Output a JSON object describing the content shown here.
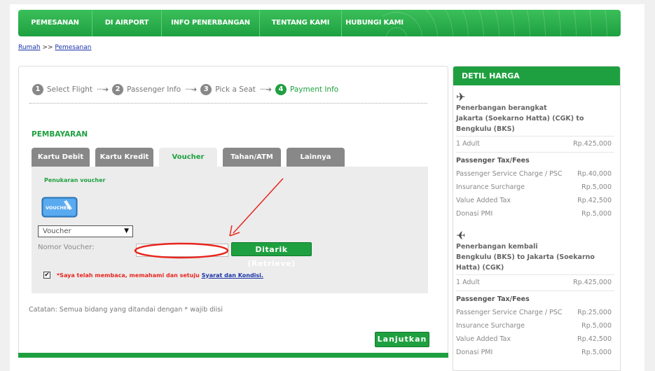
{
  "nav": {
    "items": [
      "PEMESANAN",
      "DI AIRPORT",
      "INFO PENERBANGAN",
      "TENTANG KAMI",
      "HUBUNGI KAMI"
    ]
  },
  "breadcrumb": {
    "home": "Rumah",
    "sep": ">>",
    "current": "Pemesanan"
  },
  "steps": [
    {
      "num": "1",
      "label": "Select Flight"
    },
    {
      "num": "2",
      "label": "Passenger Info"
    },
    {
      "num": "3",
      "label": "Pick a Seat"
    },
    {
      "num": "4",
      "label": "Payment Info"
    }
  ],
  "step_arrow": "····➔",
  "payment": {
    "title": "PEMBAYARAN",
    "tabs": [
      "Kartu Debit",
      "Kartu Kredit",
      "Voucher",
      "Tahan/ATM",
      "Lainnya"
    ],
    "active_tab": "Voucher",
    "voucher_heading": "Penukaran voucher",
    "voucher_card_text": "VOUCHER",
    "select_value": "Voucher",
    "voucher_label": "Nomor Voucher:",
    "voucher_value": "",
    "retrieve_label": "Ditarik (Retrieve)",
    "agree_text": "*Saya telah membaca, memahami dan setuju",
    "agree_link": "Syarat dan Kondisi.",
    "note": "Catatan: Semua bidang yang ditandai dengan * wajib diisi",
    "continue_label": "Lanjutkan"
  },
  "sidebar": {
    "title": "DETIL HARGA",
    "outbound": {
      "heading": "Penerbangan berangkat",
      "route": "Jakarta (Soekarno Hatta) (CGK) to Bengkulu (BKS)",
      "pax_label": "1 Adult",
      "pax_price": "Rp.425,000",
      "tax_title": "Passenger Tax/Fees",
      "fees": [
        {
          "label": "Passenger Service Charge / PSC",
          "value": "Rp.40,000"
        },
        {
          "label": "Insurance Surcharge",
          "value": "Rp.5,000"
        },
        {
          "label": "Value Added Tax",
          "value": "Rp.42,500"
        },
        {
          "label": "Donasi PMI",
          "value": "Rp.5,000"
        }
      ]
    },
    "return": {
      "heading": "Penerbangan kembali",
      "route": "Bengkulu (BKS) to Jakarta (Soekarno Hatta) (CGK)",
      "pax_label": "1 Adult",
      "pax_price": "Rp.425,000",
      "tax_title": "Passenger Tax/Fees",
      "fees": [
        {
          "label": "Passenger Service Charge / PSC",
          "value": "Rp.25,000"
        },
        {
          "label": "Insurance Surcharge",
          "value": "Rp.5,000"
        },
        {
          "label": "Value Added Tax",
          "value": "Rp.42,500"
        },
        {
          "label": "Donasi PMI",
          "value": "Rp.5,000"
        }
      ]
    }
  },
  "icons": {
    "depart": "airplane-depart-icon",
    "arrive": "airplane-arrive-icon",
    "check": "check-icon"
  },
  "colors": {
    "brand": "#1fa040",
    "annotation": "#e8261e"
  }
}
